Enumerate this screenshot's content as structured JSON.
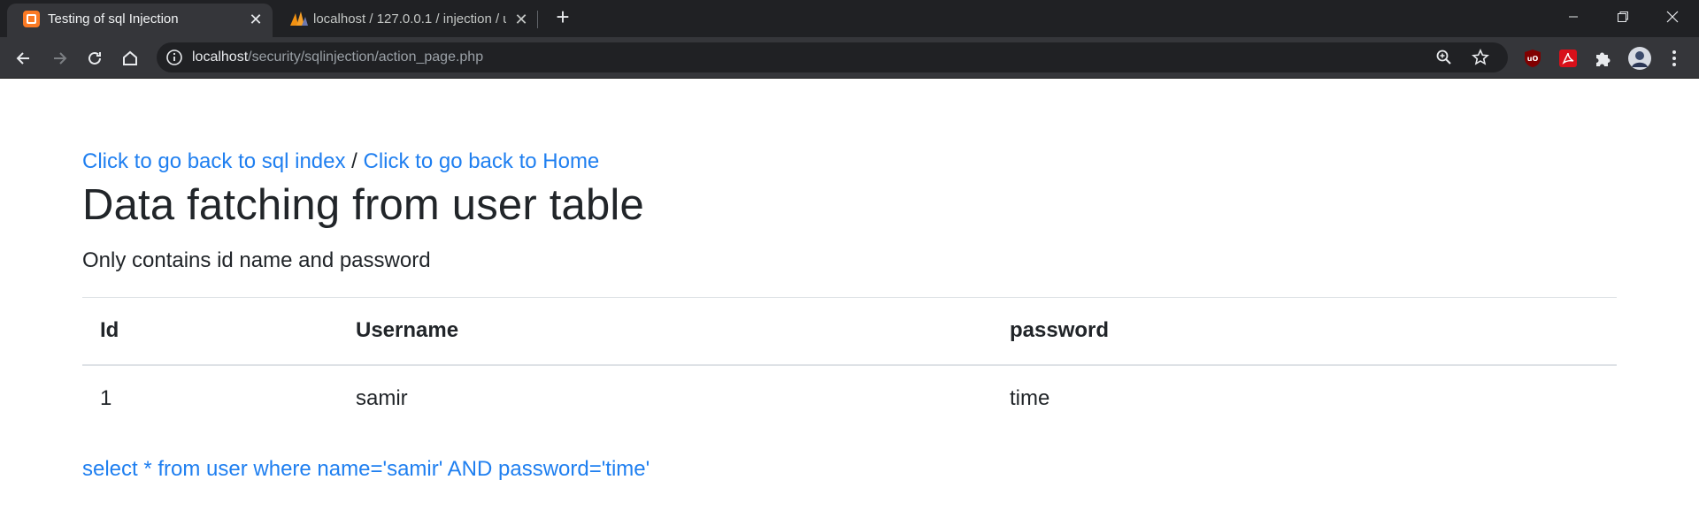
{
  "browser": {
    "tabs": [
      {
        "title": "Testing of sql Injection",
        "favicon": "xampp-icon",
        "active": true
      },
      {
        "title": "localhost / 127.0.0.1 / injection / u",
        "favicon": "phpmyadmin-icon",
        "active": false
      }
    ],
    "new_tab_label": "+",
    "close_glyph": "✕",
    "address": {
      "host": "localhost",
      "path": "/security/sqlinjection/action_page.php"
    },
    "extensions": [
      "ublock-icon",
      "pdf-icon",
      "puzzle-icon",
      "profile-avatar"
    ],
    "accent": "#35363a"
  },
  "page": {
    "links": {
      "sql_index": "Click to go back to sql index",
      "separator": " / ",
      "home": "Click to go back to Home"
    },
    "title": "Data fatching from user table",
    "subtitle": "Only contains id name and password",
    "table": {
      "headers": [
        "Id",
        "Username",
        "password"
      ],
      "rows": [
        [
          "1",
          "samir",
          "time"
        ]
      ]
    },
    "query": "select * from user where name='samir' AND password='time'",
    "link_color": "#1f7ff0"
  }
}
